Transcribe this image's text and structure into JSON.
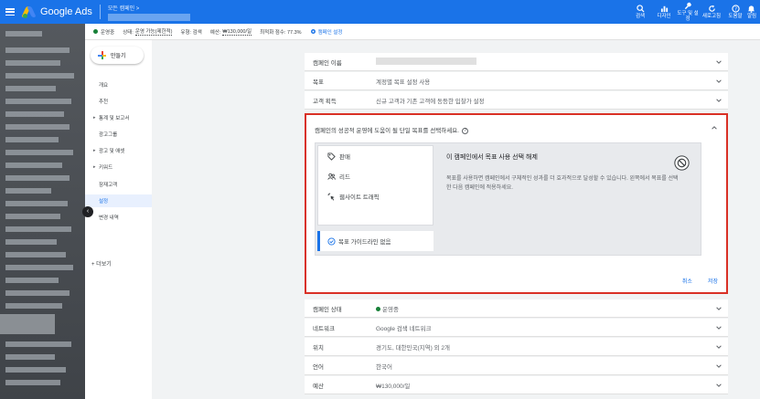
{
  "app": {
    "name": "Google Ads",
    "breadcrumb": "모든 캠페인 >"
  },
  "toolbar": {
    "actions": [
      {
        "label": "검색",
        "icon": "search-icon"
      },
      {
        "label": "디자인",
        "icon": "chart-icon"
      },
      {
        "label": "도구 및 설정",
        "icon": "wrench-icon"
      },
      {
        "label": "새로고침",
        "icon": "refresh-icon"
      },
      {
        "label": "도움말",
        "icon": "help-icon"
      },
      {
        "label": "알림",
        "icon": "bell-icon"
      }
    ]
  },
  "status": {
    "enabled": "운영중",
    "status_prefix": "상태:",
    "status_value": "운영 가능(제한적)",
    "type_prefix": "유형: 검색",
    "budget_prefix": "예산:",
    "budget_value": "₩130,000/일",
    "optimization": "최적화 점수: 77.3%",
    "settings_link": "캠페인 설정"
  },
  "sidebar": {
    "create_label": "만들기",
    "items": [
      {
        "label": "개요",
        "arrow": false,
        "active": false
      },
      {
        "label": "추천",
        "arrow": false,
        "active": false
      },
      {
        "label": "통계 및 보고서",
        "arrow": true,
        "active": false
      },
      {
        "label": "광고그룹",
        "arrow": false,
        "active": false
      },
      {
        "label": "광고 및 애셋",
        "arrow": true,
        "active": false
      },
      {
        "label": "키워드",
        "arrow": true,
        "active": false
      },
      {
        "label": "잠재고객",
        "arrow": false,
        "active": false
      },
      {
        "label": "설정",
        "arrow": false,
        "active": true
      },
      {
        "label": "변경 내역",
        "arrow": false,
        "active": false
      }
    ],
    "more_label": "+  더보기"
  },
  "settings_rows_top": [
    {
      "label": "캠페인 이름",
      "value": "",
      "blurred": true
    },
    {
      "label": "목표",
      "value": "계정별 목표 설정 사용"
    },
    {
      "label": "고객 획득",
      "value": "신규 고객과 기존 고객에 동등한 입찰가 설정"
    }
  ],
  "goal_panel": {
    "header": "캠페인의 성공적 운영에 도움이 될 단일 목표를 선택하세요.",
    "help": "?",
    "options": [
      {
        "label": "판매",
        "icon": "tag-icon"
      },
      {
        "label": "리드",
        "icon": "people-icon"
      },
      {
        "label": "웹사이트 트래픽",
        "icon": "cursor-click-icon"
      }
    ],
    "guide_label": "목표 가이드라인 없음",
    "detail_title": "이 캠페인에서 목표 사용 선택 해제",
    "detail_desc": "목표를 사용하면 캠페인에서 구체적인 성과를 더 효과적으로 달성할 수 있습니다. 왼쪽에서 목표를 선택한 다음 캠페인에 적용하세요.",
    "cancel_label": "취소",
    "save_label": "저장"
  },
  "settings_rows_bottom": [
    {
      "label": "캠페인 상태",
      "value": "운영중",
      "dot": true
    },
    {
      "label": "네트워크",
      "value": "Google 검색 네트워크"
    },
    {
      "label": "위치",
      "value": "경기도, 대한민국(지역) 외 2개"
    },
    {
      "label": "언어",
      "value": "한국어"
    },
    {
      "label": "예산",
      "value": "₩130,000/일"
    }
  ],
  "colors": {
    "brand": "#1a73e8",
    "highlight_border": "#d93025",
    "status_green": "#188038"
  }
}
